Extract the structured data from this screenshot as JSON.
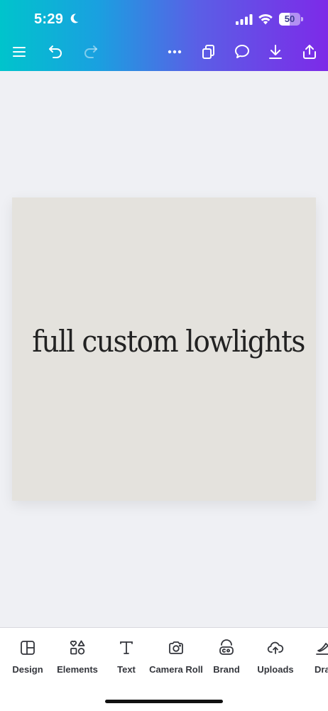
{
  "status_bar": {
    "time": "5:29",
    "battery_percent": "50",
    "battery_level": 0.5
  },
  "toolbar": {
    "buttons": [
      "menu-icon",
      "undo-icon",
      "redo-icon",
      "more-icon",
      "pages-icon",
      "comment-icon",
      "download-icon",
      "share-icon"
    ]
  },
  "canvas": {
    "text": "full custom lowlights",
    "background_color": "#e4e2dd"
  },
  "bottom_tools": [
    {
      "label": "Design",
      "icon": "design-icon"
    },
    {
      "label": "Elements",
      "icon": "elements-icon"
    },
    {
      "label": "Text",
      "icon": "text-icon"
    },
    {
      "label": "Camera Roll",
      "icon": "camera-icon"
    },
    {
      "label": "Brand",
      "icon": "brand-icon"
    },
    {
      "label": "Uploads",
      "icon": "uploads-icon"
    },
    {
      "label": "Dra",
      "icon": "draw-icon"
    }
  ],
  "theme": {
    "gradient_start": "#00c4cc",
    "gradient_end": "#7d2ae8",
    "text_dark": "#34363c"
  }
}
